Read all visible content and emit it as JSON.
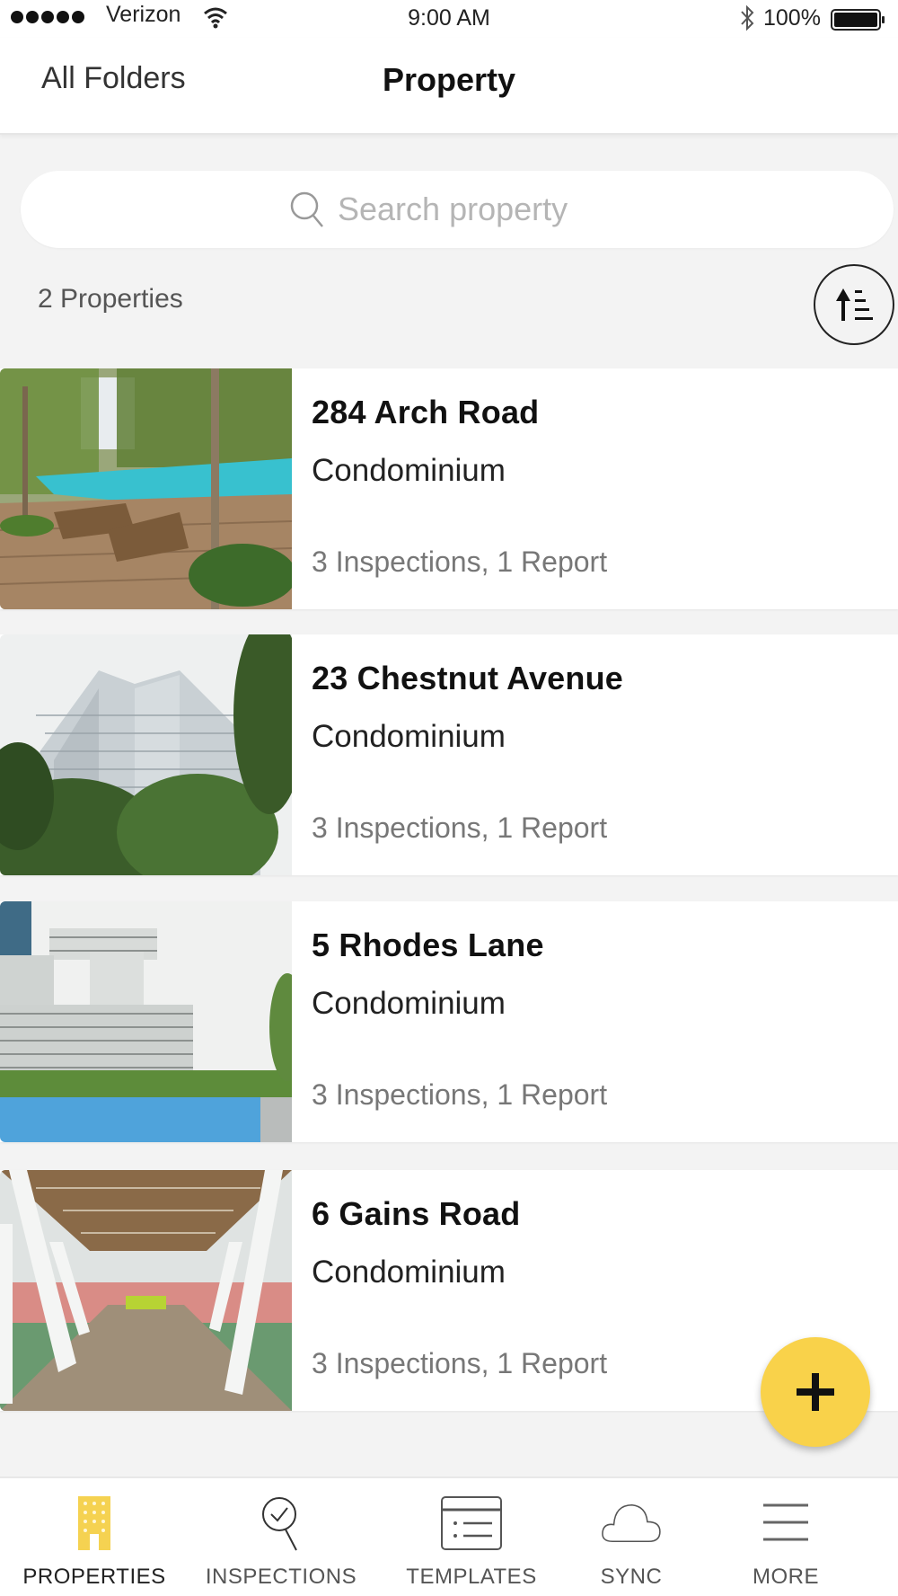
{
  "status_bar": {
    "carrier": "Verizon",
    "time": "9:00 AM",
    "battery": "100%",
    "signal_bars": 5
  },
  "nav": {
    "back_label": "All Folders",
    "title": "Property"
  },
  "search": {
    "placeholder": "Search property",
    "value": ""
  },
  "list": {
    "count_label": "2 Properties",
    "sort_icon": "sort-ascending-icon"
  },
  "properties": [
    {
      "name": "284 Arch Road",
      "type": "Condominium",
      "stats": "3 Inspections, 1 Report",
      "image": "pool-deck-photo"
    },
    {
      "name": "23 Chestnut Avenue",
      "type": "Condominium",
      "stats": "3 Inspections, 1 Report",
      "image": "tower-photo"
    },
    {
      "name": "5 Rhodes Lane",
      "type": "Condominium",
      "stats": "3 Inspections, 1 Report",
      "image": "stacked-building-pool-photo"
    },
    {
      "name": "6 Gains Road",
      "type": "Condominium",
      "stats": "3 Inspections, 1 Report",
      "image": "covered-walkway-photo"
    }
  ],
  "fab": {
    "icon": "plus-icon"
  },
  "tabs": [
    {
      "label": "PROPERTIES",
      "icon": "building-icon",
      "active": true
    },
    {
      "label": "INSPECTIONS",
      "icon": "inspection-search-icon",
      "active": false
    },
    {
      "label": "TEMPLATES",
      "icon": "template-list-icon",
      "active": false
    },
    {
      "label": "SYNC",
      "icon": "cloud-icon",
      "active": false
    },
    {
      "label": "MORE",
      "icon": "menu-icon",
      "active": false
    }
  ],
  "colors": {
    "accent": "#F9D24A",
    "background": "#F3F3F3",
    "card": "#FFFFFF",
    "muted_text": "#777777"
  }
}
